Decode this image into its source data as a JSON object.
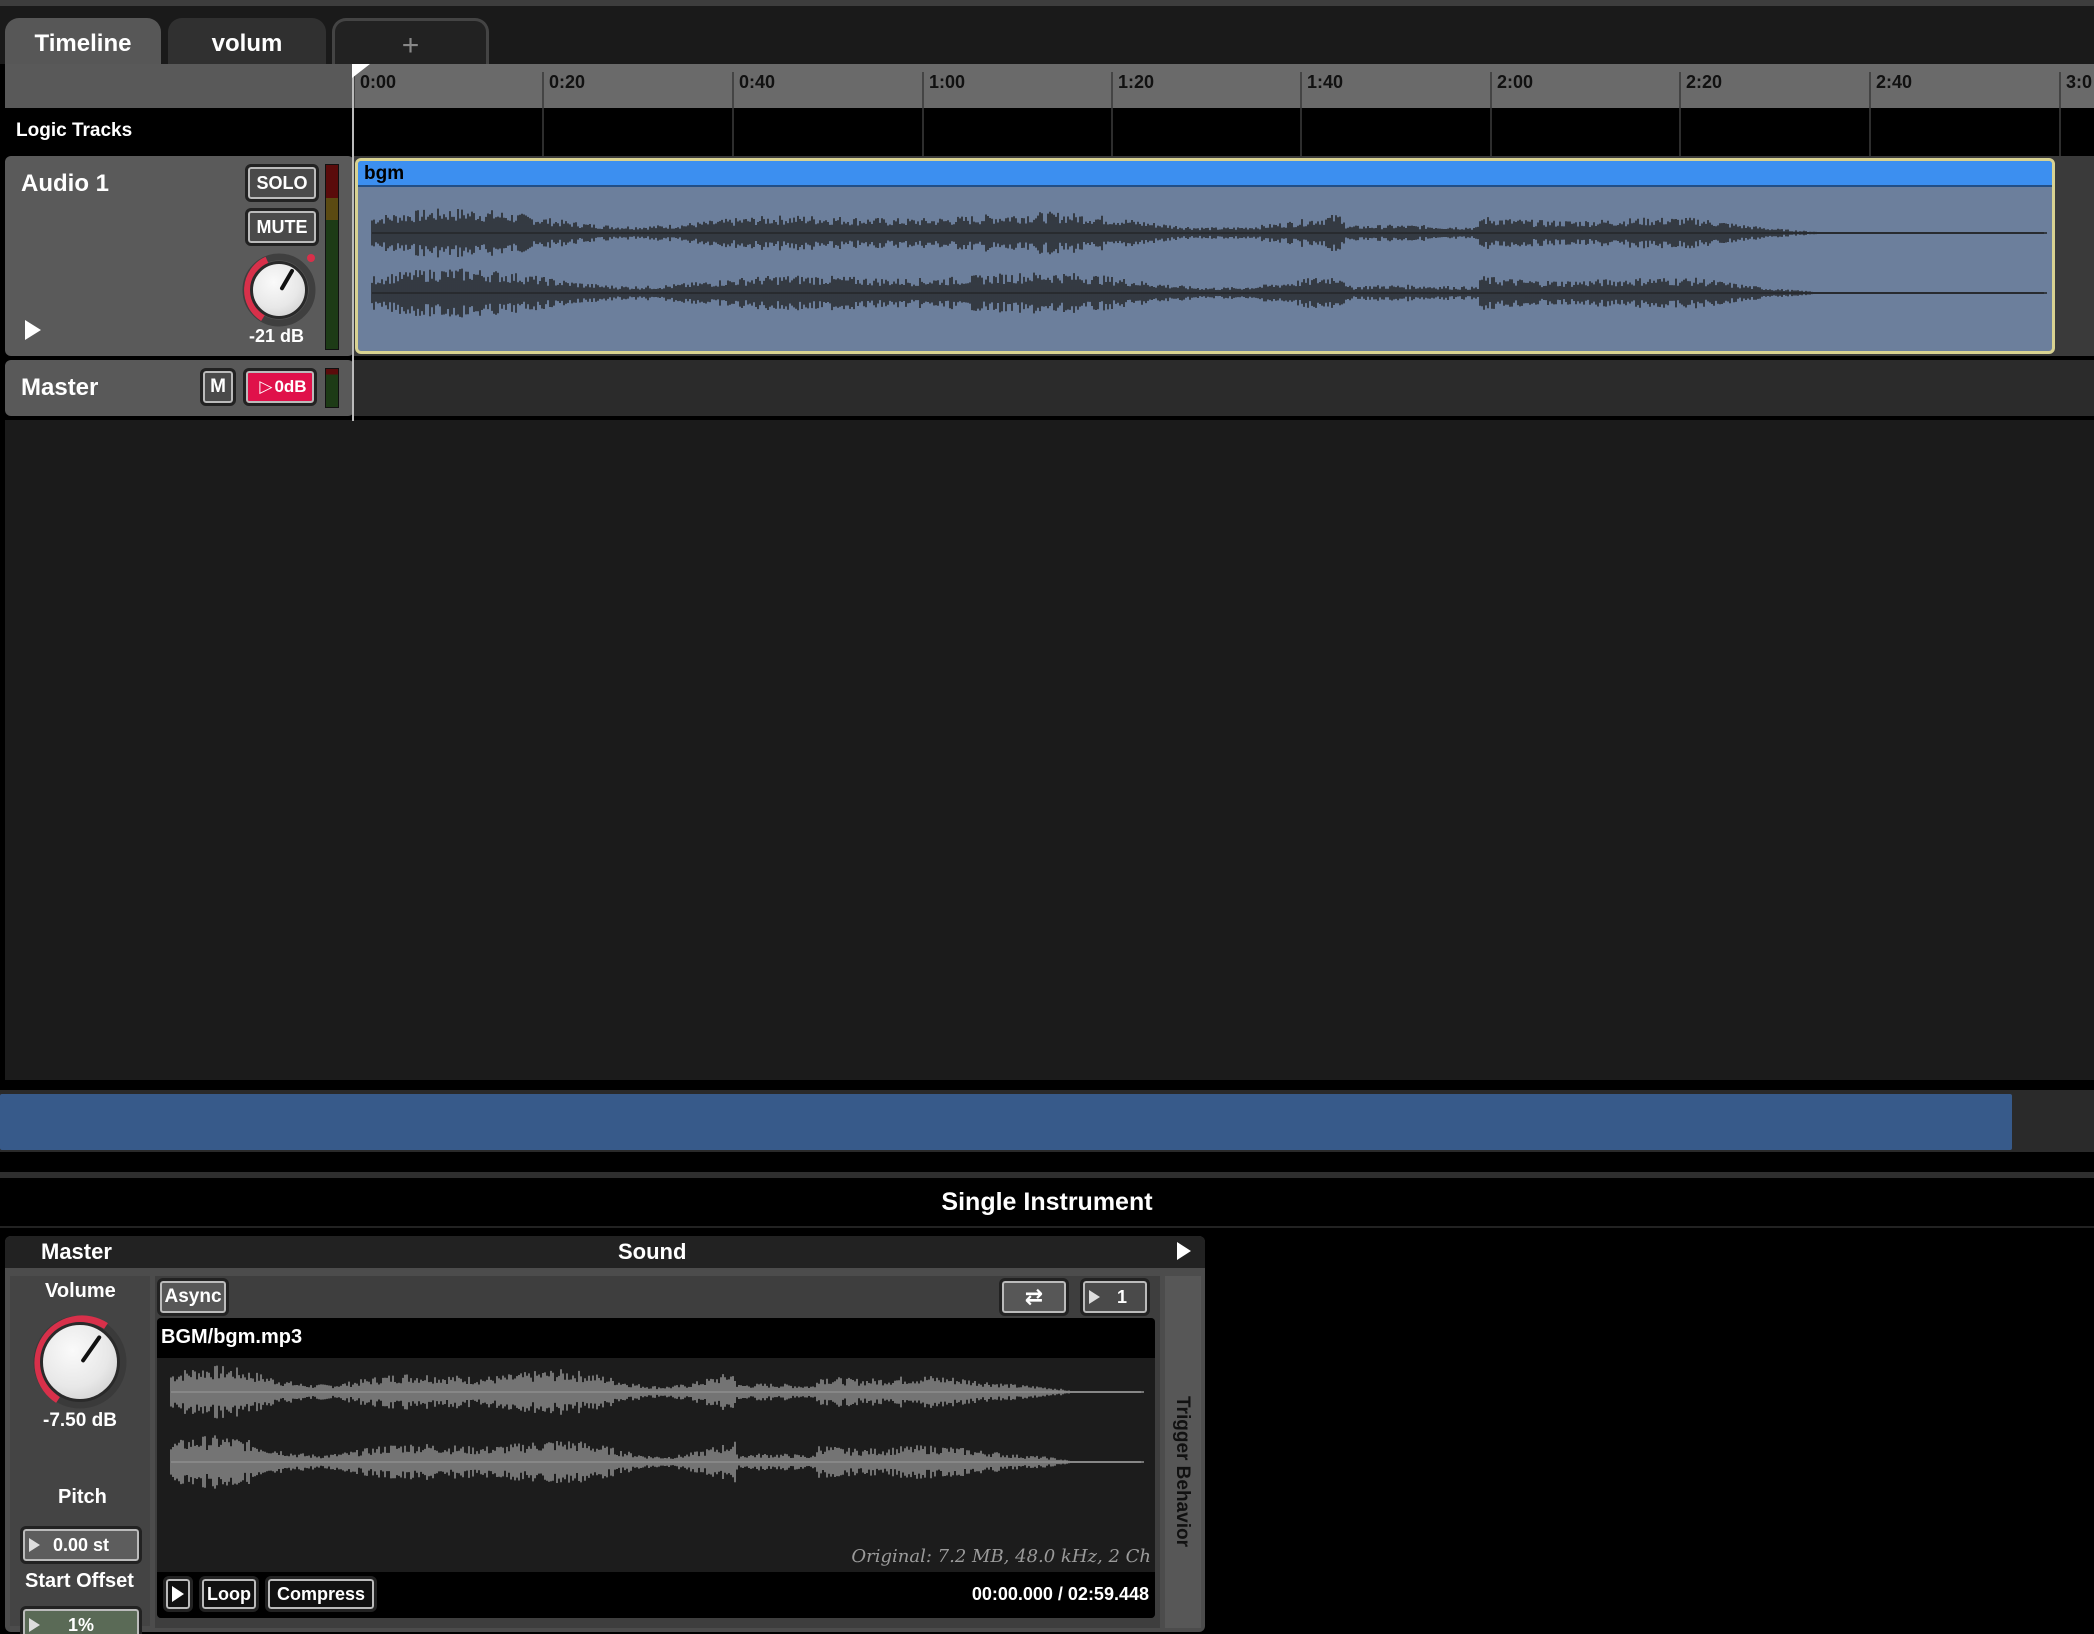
{
  "tabs": [
    {
      "label": "Timeline"
    },
    {
      "label": "volum"
    },
    {
      "label": "+"
    }
  ],
  "ruler": {
    "ticks": [
      "0:00",
      "0:20",
      "0:40",
      "1:00",
      "1:20",
      "1:40",
      "2:00",
      "2:20",
      "2:40",
      "3:0"
    ]
  },
  "logic_tracks": {
    "label": "Logic Tracks"
  },
  "audio_track": {
    "name": "Audio 1",
    "solo_label": "SOLO",
    "mute_label": "MUTE",
    "volume": "-21 dB",
    "clip": {
      "name": "bgm"
    }
  },
  "master_track": {
    "name": "Master",
    "mute_label": "M",
    "volume": "0dB"
  },
  "panel": {
    "title": "Single Instrument",
    "master_header": "Master",
    "sound_header": "Sound",
    "volume_label": "Volume",
    "volume_value": "-7.50 dB",
    "pitch_label": "Pitch",
    "pitch_value": "0.00 st",
    "start_offset_label": "Start Offset",
    "start_offset_value": "1%",
    "async_label": "Async",
    "loop_count": "1",
    "file_name": "BGM/bgm.mp3",
    "original_info": "Original: 7.2 MB, 48.0 kHz, 2 Ch",
    "loop_label": "Loop",
    "compress_label": "Compress",
    "time_display": "00:00.000 / 02:59.448",
    "trigger_label": "Trigger Behavior"
  },
  "colors": {
    "clip_header": "#3c8ff0",
    "clip_body": "#6c7f9c",
    "clip_border": "#d8d292",
    "scroll_thumb": "#375a8a",
    "knob_arc": "#d8304a",
    "master_volume_field": "#e0114a"
  }
}
